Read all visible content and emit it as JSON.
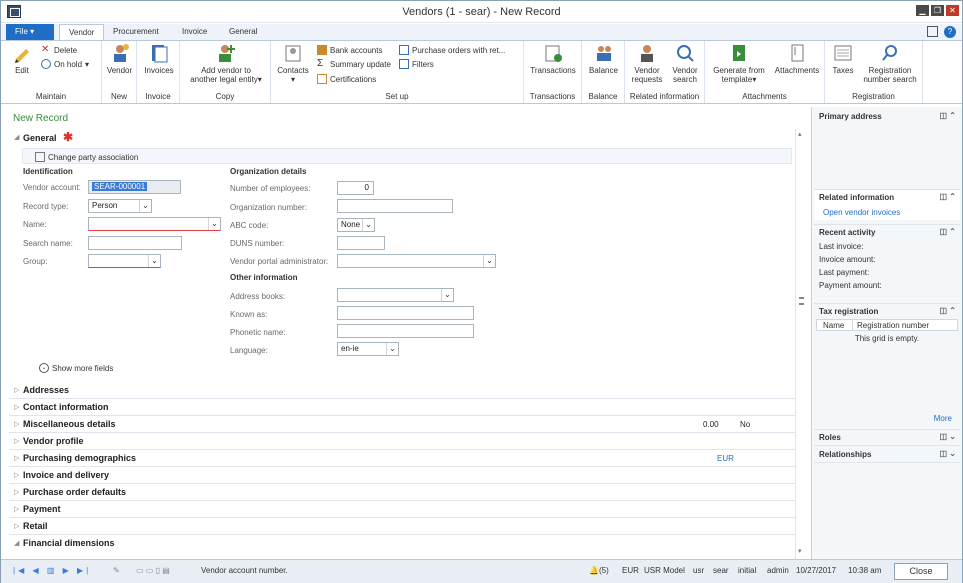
{
  "window": {
    "title": "Vendors (1 - sear) - New Record"
  },
  "tabs": [
    "File",
    "Vendor",
    "Procurement",
    "Invoice",
    "General"
  ],
  "ribbon": {
    "maintain": {
      "edit": "Edit",
      "delete": "Delete",
      "on_hold": "On hold",
      "label": "Maintain"
    },
    "new": {
      "vendor": "Vendor",
      "label": "New"
    },
    "invoice": {
      "invoices": "Invoices",
      "label": "Invoice"
    },
    "copy": {
      "add_vendor": "Add vendor to",
      "add_vendor2": "another legal entity",
      "label": "Copy"
    },
    "setup": {
      "contacts": "Contacts",
      "bank_accounts": "Bank accounts",
      "summary_update": "Summary update",
      "certifications": "Certifications",
      "purchase_orders_with_ret": "Purchase orders with ret...",
      "filters": "Filters",
      "label": "Set up"
    },
    "transactions": {
      "transactions": "Transactions",
      "label": "Transactions"
    },
    "balance": {
      "balance": "Balance",
      "label": "Balance"
    },
    "related": {
      "vendor_requests": "Vendor",
      "vendor_requests2": "requests",
      "vendor_search": "Vendor",
      "vendor_search2": "search",
      "label": "Related information"
    },
    "attachments": {
      "generate": "Generate from",
      "generate2": "template",
      "attachments": "Attachments",
      "label": "Attachments"
    },
    "registration": {
      "taxes": "Taxes",
      "reg_search": "Registration",
      "reg_search2": "number search",
      "label": "Registration"
    }
  },
  "form": {
    "heading": "New Record",
    "general": "General",
    "change_party": "Change party association",
    "identification": "Identification",
    "vendor_account_label": "Vendor account:",
    "vendor_account_value": "SEAR-000001",
    "record_type_label": "Record type:",
    "record_type_value": "Person",
    "name_label": "Name:",
    "search_name_label": "Search name:",
    "group_label": "Group:",
    "org_details": "Organization details",
    "employees_label": "Number of employees:",
    "employees_value": "0",
    "org_number_label": "Organization number:",
    "abc_label": "ABC code:",
    "abc_value": "None",
    "duns_label": "DUNS number:",
    "portal_admin_label": "Vendor portal administrator:",
    "other_info": "Other information",
    "address_books_label": "Address books:",
    "known_as_label": "Known as:",
    "phonetic_label": "Phonetic name:",
    "language_label": "Language:",
    "language_value": "en-ie",
    "show_more": "Show more fields",
    "fasttabs": [
      "Addresses",
      "Contact information",
      "Miscellaneous details",
      "Vendor profile",
      "Purchasing demographics",
      "Invoice and delivery",
      "Purchase order defaults",
      "Payment",
      "Retail",
      "Financial dimensions"
    ],
    "misc_value1": "0.00",
    "misc_value2": "No",
    "purch_value": "EUR"
  },
  "factbox": {
    "primary_address": "Primary address",
    "related_info": "Related information",
    "open_vendor_invoices": "Open vendor invoices",
    "recent_activity": "Recent activity",
    "last_invoice": "Last invoice:",
    "invoice_amount": "Invoice amount:",
    "last_payment": "Last payment:",
    "payment_amount": "Payment amount:",
    "tax_registration": "Tax registration",
    "col_name": "Name",
    "col_reg": "Registration number",
    "empty": "This grid is empty.",
    "more": "More",
    "roles": "Roles",
    "relationships": "Relationships"
  },
  "status": {
    "help_text": "Vendor account number.",
    "notifications": "(5)",
    "currency": "EUR",
    "model": "USR Model",
    "layer": "usr",
    "company": "sear",
    "partition": "initial",
    "user": "admin",
    "date": "10/27/2017",
    "time": "10:38 am",
    "close": "Close"
  },
  "colors": {
    "accent": "#1f6dc4",
    "heading_green": "#3b8e3b"
  }
}
